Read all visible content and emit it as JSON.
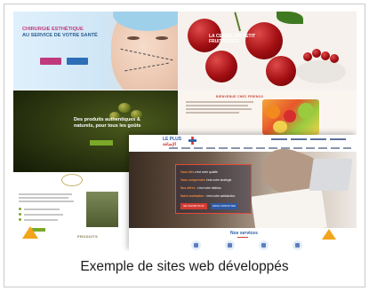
{
  "caption": "Exemple de sites web développés",
  "sites": {
    "surgery": {
      "headline_line1": "CHIRURGIE ESTHÉTIQUE",
      "headline_line2": "AU SERVICE DE VOTRE SANTÉ",
      "accent_color": "#c0397d"
    },
    "cherry": {
      "headline": "LA CERISE, UN PETIT FRUIT ROUGE",
      "accent_color": "#a10e12"
    },
    "fruits": {
      "welcome": "BIENVENUE CHEZ FRIENOX"
    },
    "olive": {
      "headline": "Des produits authentiques & naturels, pour tous les goûts",
      "products_label": "PRODUITS",
      "accent_color": "#7ba828"
    },
    "insurance": {
      "logo_latin": "LE PLUS",
      "logo_arabic": "الإضافة",
      "hero_lines": [
        [
          "Vous êtes",
          "souhaitez :",
          " c'est votre qualité"
        ],
        [
          "Vous comprendre",
          "",
          " c'est notre stratégie"
        ],
        [
          "Nos offres",
          "",
          " : c'est votre tableau"
        ],
        [
          "Notre motivation",
          "",
          " : c'est votre satisfaction"
        ]
      ],
      "btn_primary": "EN SAVOIR PLUS",
      "btn_secondary": "NOUS CONTACTER",
      "services_title": "Nos services",
      "brand_blue": "#2c5aa8",
      "brand_red": "#d43b33"
    }
  }
}
